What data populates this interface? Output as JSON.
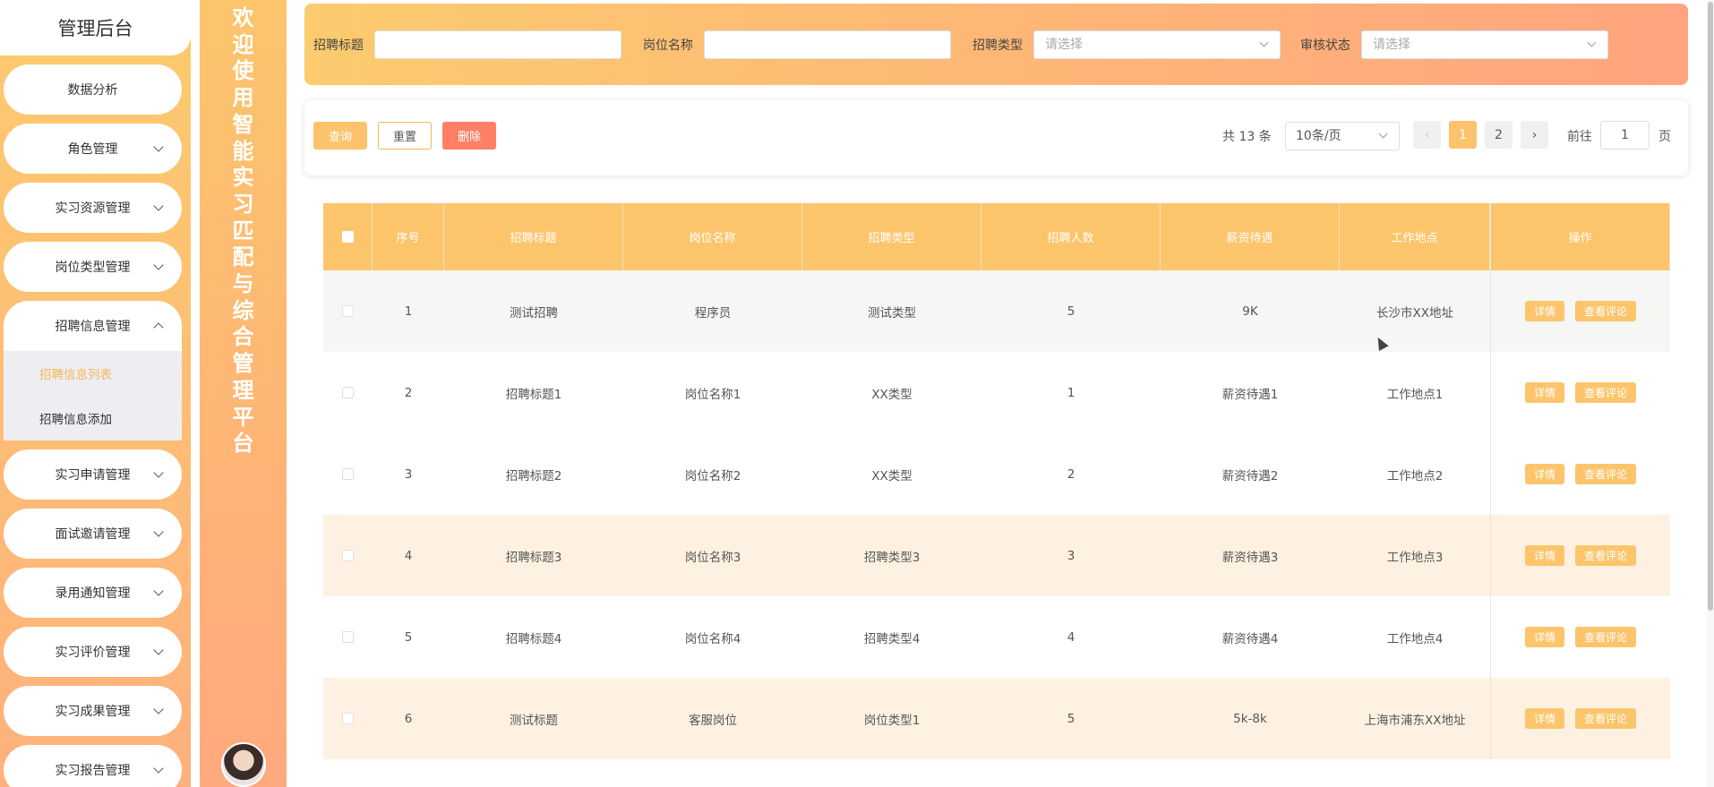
{
  "sidebar": {
    "brand": "管理后台",
    "items": [
      {
        "label": "数据分析",
        "has_chevron": false
      },
      {
        "label": "角色管理",
        "has_chevron": true
      },
      {
        "label": "实习资源管理",
        "has_chevron": true
      },
      {
        "label": "岗位类型管理",
        "has_chevron": true
      },
      {
        "label": "招聘信息管理",
        "has_chevron": true,
        "open": true
      },
      {
        "label": "实习申请管理",
        "has_chevron": true
      },
      {
        "label": "面试邀请管理",
        "has_chevron": true
      },
      {
        "label": "录用通知管理",
        "has_chevron": true
      },
      {
        "label": "实习评价管理",
        "has_chevron": true
      },
      {
        "label": "实习成果管理",
        "has_chevron": true
      },
      {
        "label": "实习报告管理",
        "has_chevron": true
      }
    ],
    "submenu": [
      {
        "label": "招聘信息列表",
        "active": true
      },
      {
        "label": "招聘信息添加",
        "active": false
      }
    ]
  },
  "banner": {
    "title": "欢迎使用智能实习匹配与综合管理平台"
  },
  "filter": {
    "title_label": "招聘标题",
    "title_value": "",
    "position_label": "岗位名称",
    "position_value": "",
    "type_label": "招聘类型",
    "type_placeholder": "请选择",
    "status_label": "审核状态",
    "status_placeholder": "请选择"
  },
  "toolbar": {
    "search_label": "查询",
    "reset_label": "重置",
    "delete_label": "删除"
  },
  "pagination": {
    "total_text": "共 13 条",
    "page_size": "10条/页",
    "pages": [
      "1",
      "2"
    ],
    "current_page": "1",
    "goto_label": "前往",
    "goto_value": "1",
    "goto_suffix": "页"
  },
  "table": {
    "headers": [
      "序号",
      "招聘标题",
      "岗位名称",
      "招聘类型",
      "招聘人数",
      "薪资待遇",
      "工作地点",
      "操作"
    ],
    "detail_label": "详情",
    "review_label": "查看评论",
    "rows": [
      {
        "no": "1",
        "title": "测试招聘",
        "position": "程序员",
        "type": "测试类型",
        "count": "5",
        "salary": "9K",
        "location": "长沙市XX地址"
      },
      {
        "no": "2",
        "title": "招聘标题1",
        "position": "岗位名称1",
        "type": "XX类型",
        "count": "1",
        "salary": "薪资待遇1",
        "location": "工作地点1"
      },
      {
        "no": "3",
        "title": "招聘标题2",
        "position": "岗位名称2",
        "type": "XX类型",
        "count": "2",
        "salary": "薪资待遇2",
        "location": "工作地点2"
      },
      {
        "no": "4",
        "title": "招聘标题3",
        "position": "岗位名称3",
        "type": "招聘类型3",
        "count": "3",
        "salary": "薪资待遇3",
        "location": "工作地点3"
      },
      {
        "no": "5",
        "title": "招聘标题4",
        "position": "岗位名称4",
        "type": "招聘类型4",
        "count": "4",
        "salary": "薪资待遇4",
        "location": "工作地点4"
      },
      {
        "no": "6",
        "title": "测试标题",
        "position": "客服岗位",
        "type": "岗位类型1",
        "count": "5",
        "salary": "5k-8k",
        "location": "上海市浦东XX地址"
      }
    ]
  }
}
